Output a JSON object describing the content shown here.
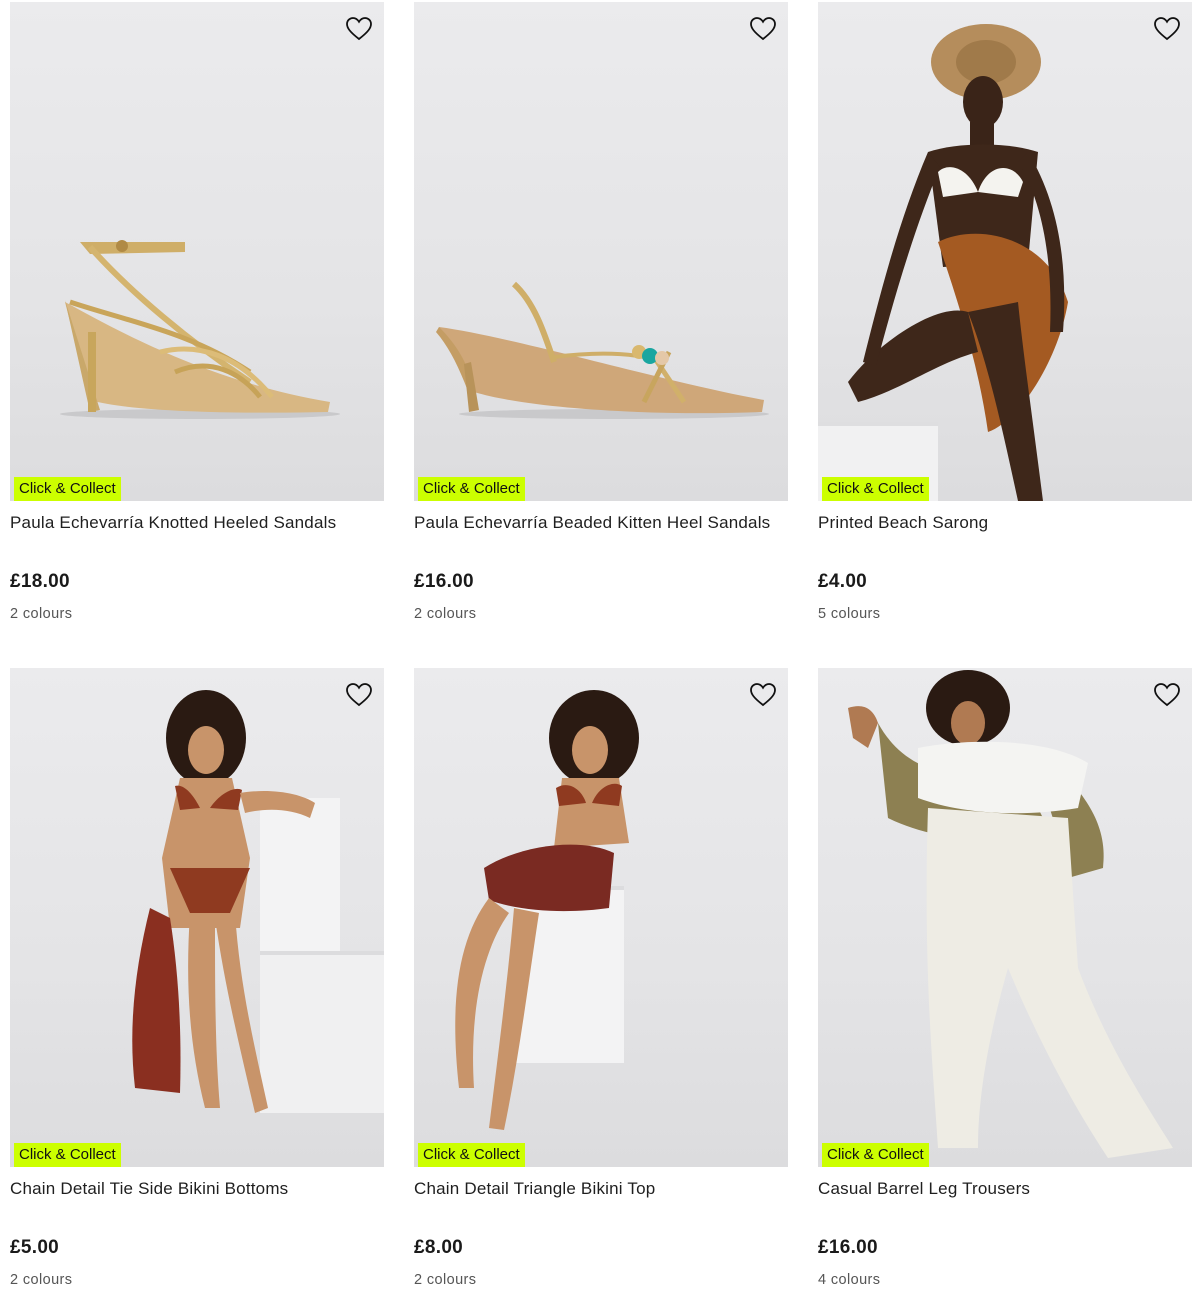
{
  "products": [
    {
      "title": "Paula Echevarría Knotted Heeled Sandals",
      "price": "£18.00",
      "colours": "2 colours",
      "badge": "Click & Collect"
    },
    {
      "title": "Paula Echevarría Beaded Kitten Heel Sandals",
      "price": "£16.00",
      "colours": "2 colours",
      "badge": "Click & Collect"
    },
    {
      "title": "Printed Beach Sarong",
      "price": "£4.00",
      "colours": "5 colours",
      "badge": "Click & Collect"
    },
    {
      "title": "Chain Detail Tie Side Bikini Bottoms",
      "price": "£5.00",
      "colours": "2 colours",
      "badge": "Click & Collect"
    },
    {
      "title": "Chain Detail Triangle Bikini Top",
      "price": "£8.00",
      "colours": "2 colours",
      "badge": "Click & Collect"
    },
    {
      "title": "Casual Barrel Leg Trousers",
      "price": "£16.00",
      "colours": "4 colours",
      "badge": "Click & Collect"
    }
  ],
  "icons": {
    "wishlist": "heart-outline-icon"
  },
  "colors": {
    "badge_bg": "#ccff00",
    "text": "#1f1f1f",
    "muted": "#555555"
  }
}
